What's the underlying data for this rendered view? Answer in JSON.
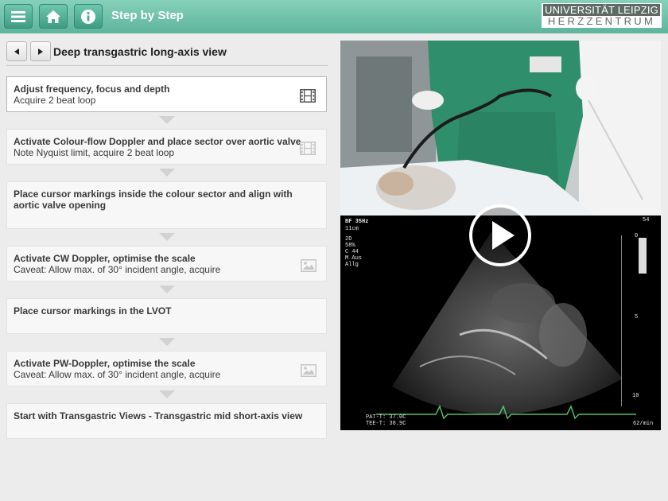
{
  "header": {
    "title": "Step by Step",
    "logo_line1": "UNIVERSITÄT LEIPZIG",
    "logo_line2": "HERZZENTRUM",
    "menu_icon": "menu-icon",
    "home_icon": "home-icon",
    "info_icon": "info-icon"
  },
  "view": {
    "title": "Deep transgastric long-axis view",
    "prev_icon": "chevron-left-icon",
    "next_icon": "chevron-right-icon"
  },
  "steps": [
    {
      "title": "Adjust frequency, focus and depth",
      "subtitle": "Acquire 2 beat loop",
      "icon": "film-icon"
    },
    {
      "title": "Activate Colour-flow Doppler and place sector over aortic valve",
      "subtitle": "Note Nyquist limit, acquire 2 beat loop",
      "icon": "film-icon"
    },
    {
      "title": "Place cursor markings inside the colour sector and align with aortic valve opening",
      "subtitle": "",
      "icon": ""
    },
    {
      "title": "Activate CW Doppler, optimise the scale",
      "subtitle": "Caveat: Allow max. of 30° incident angle, acquire",
      "icon": "image-icon"
    },
    {
      "title": "Place cursor markings in the LVOT",
      "subtitle": "",
      "icon": ""
    },
    {
      "title": "Activate PW-Doppler, optimise the scale",
      "subtitle": "Caveat: Allow max. of 30° incident angle, acquire",
      "icon": "image-icon"
    },
    {
      "title": "Start with Transgastric Views - Transgastric mid short-axis view",
      "subtitle": "",
      "icon": ""
    }
  ],
  "video": {
    "play_icon": "play-icon",
    "echo_header": "BF 35Hz",
    "echo_depth": "11cm",
    "echo_params": [
      "2D",
      "58%",
      "C 44",
      "M Aus",
      "Allg"
    ],
    "scale_marks": [
      "0",
      "5",
      "10"
    ],
    "temp1": "PAT-T: 37.0C",
    "temp2": "TEE-T: 38.9C",
    "heart_rate": "62/min",
    "small_marker": "54"
  },
  "colors": {
    "header": "#5fb49c",
    "background": "#ececec",
    "active_step": "#ffffff",
    "step": "#f7f7f7"
  }
}
